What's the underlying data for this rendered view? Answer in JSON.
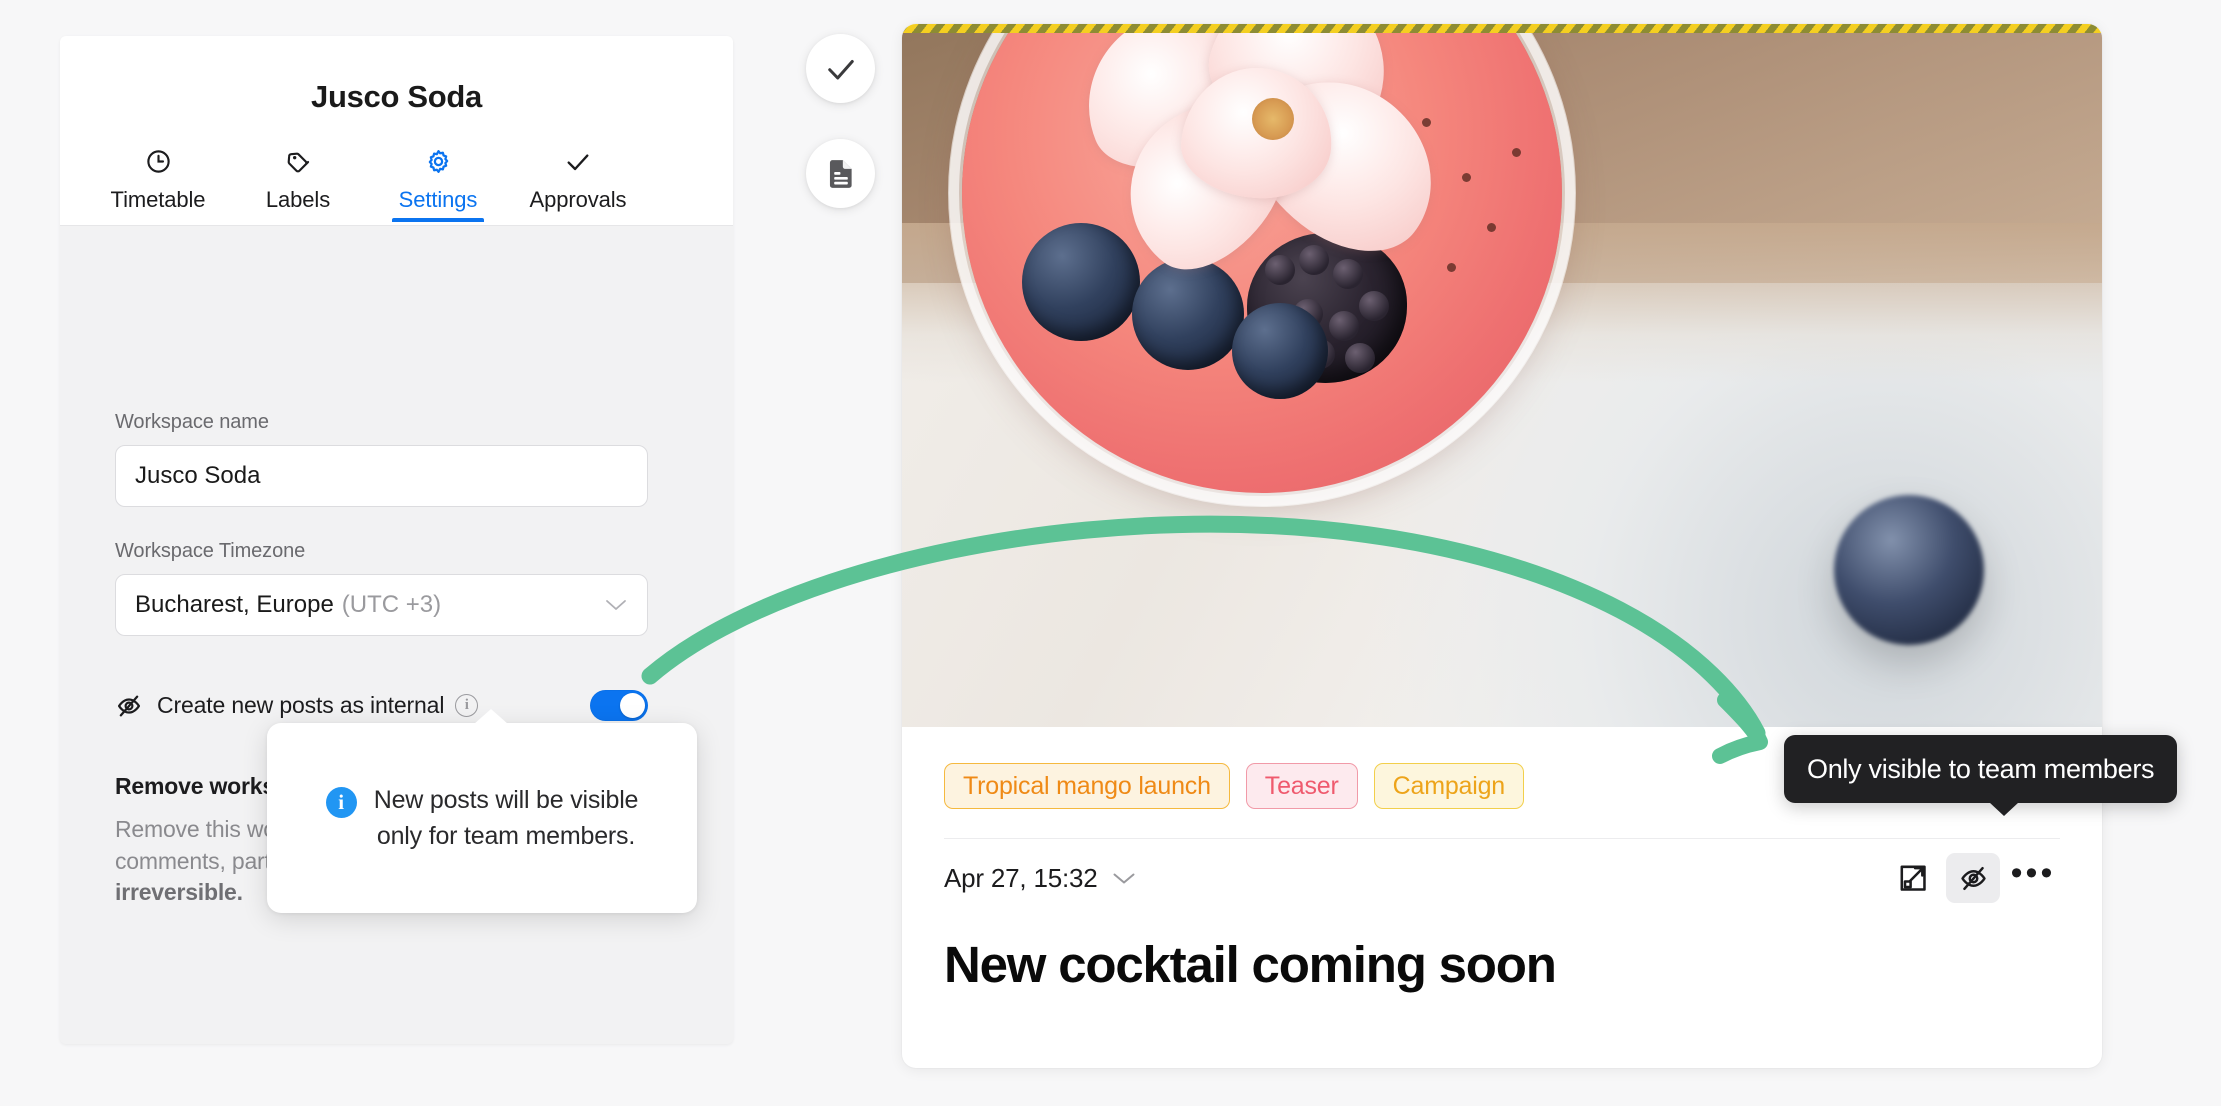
{
  "workspace_panel": {
    "title": "Jusco Soda",
    "tabs": [
      {
        "label": "Timetable",
        "icon": "clock-icon",
        "active": false
      },
      {
        "label": "Labels",
        "icon": "tag-icon",
        "active": false
      },
      {
        "label": "Settings",
        "icon": "gear-icon",
        "active": true
      },
      {
        "label": "Approvals",
        "icon": "check-icon",
        "active": false
      }
    ],
    "fields": {
      "name_label": "Workspace name",
      "name_value": "Jusco Soda",
      "name_placeholder": "Workspace name",
      "timezone_label": "Workspace Timezone",
      "timezone_value": "Bucharest, Europe",
      "timezone_offset": "(UTC +3)"
    },
    "internal_toggle": {
      "label": "Create new posts as internal",
      "info_glyph": "i",
      "state": "on",
      "accent_color": "#0b74f0"
    },
    "danger": {
      "title": "Remove workspace",
      "line1": "Remove this workspace with all posts,",
      "line2": "comments, partners and labels. This action is",
      "line3": "irreversible."
    }
  },
  "info_popover": {
    "badge_glyph": "i",
    "line1": "New posts will be visible",
    "line2": "only for team members.",
    "badge_color": "#2196f3"
  },
  "floating_buttons": [
    {
      "name": "approve-check-button",
      "icon": "check-icon"
    },
    {
      "name": "document-button",
      "icon": "document-icon"
    }
  ],
  "post_card": {
    "labels": [
      {
        "text": "Tropical mango launch",
        "color": "#ef8a16",
        "bg": "#fdf3e0",
        "border": "#f5b93f"
      },
      {
        "text": "Teaser",
        "color": "#ef5a6e",
        "bg": "#fdeaee",
        "border": "#f19aa8"
      },
      {
        "text": "Campaign",
        "color": "#eda41a",
        "bg": "#fdf6dd",
        "border": "#f2cf4b"
      }
    ],
    "date": "Apr 27, 15:32",
    "title": "New cocktail coming soon",
    "actions": [
      {
        "name": "expand-icon"
      },
      {
        "name": "eye-off-icon"
      },
      {
        "name": "more-options-icon"
      }
    ]
  },
  "dark_tooltip": {
    "text": "Only visible to team members"
  },
  "annotation": {
    "arrow_color": "#5cc295"
  }
}
